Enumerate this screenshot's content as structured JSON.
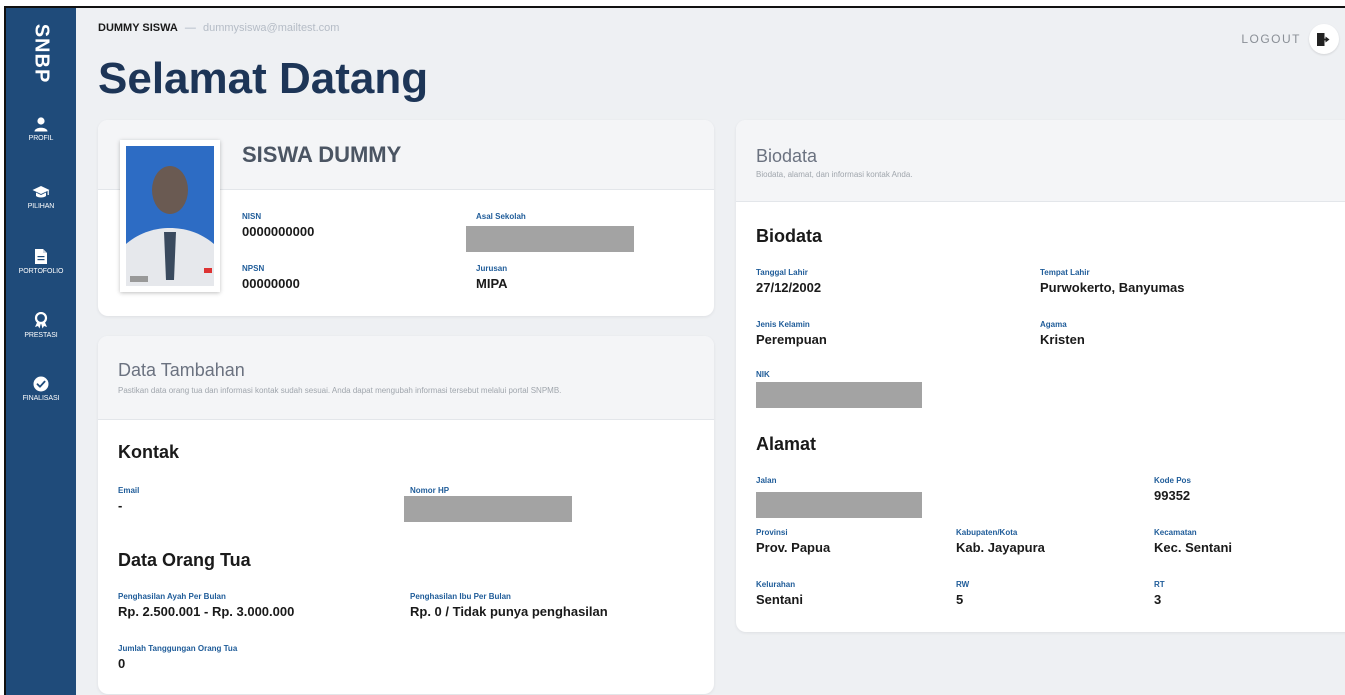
{
  "sidebar": {
    "brand": "SNBP",
    "items": [
      {
        "label": "PROFIL",
        "icon": "user-icon"
      },
      {
        "label": "PILIHAN",
        "icon": "graduation-cap-icon"
      },
      {
        "label": "PORTOFOLIO",
        "icon": "document-icon"
      },
      {
        "label": "PRESTASI",
        "icon": "award-icon"
      },
      {
        "label": "FINALISASI",
        "icon": "check-circle-icon"
      }
    ]
  },
  "header": {
    "user_name": "DUMMY SISWA",
    "separator": "—",
    "user_email": "dummysiswa@mailtest.com",
    "logout_label": "LOGOUT",
    "logout_icon": "logout-icon",
    "page_title": "Selamat Datang"
  },
  "profile": {
    "name": "SISWA DUMMY",
    "nisn_label": "NISN",
    "nisn": "0000000000",
    "npsn_label": "NPSN",
    "npsn": "00000000",
    "school_label": "Asal Sekolah",
    "major_label": "Jurusan",
    "major": "MIPA"
  },
  "tambahan": {
    "title": "Data Tambahan",
    "subtitle": "Pastikan data orang tua dan informasi kontak sudah sesuai. Anda dapat mengubah informasi tersebut melalui portal SNPMB.",
    "kontak_title": "Kontak",
    "email_label": "Email",
    "email": "-",
    "phone_label": "Nomor HP",
    "ortu_title": "Data Orang Tua",
    "father_income_label": "Penghasilan Ayah Per Bulan",
    "father_income": "Rp. 2.500.001 - Rp. 3.000.000",
    "mother_income_label": "Penghasilan Ibu Per Bulan",
    "mother_income": "Rp. 0 / Tidak punya penghasilan",
    "dependents_label": "Jumlah Tanggungan Orang Tua",
    "dependents": "0"
  },
  "biodata": {
    "card_title": "Biodata",
    "card_subtitle": "Biodata, alamat, dan informasi kontak Anda.",
    "section_title": "Biodata",
    "dob_label": "Tanggal Lahir",
    "dob": "27/12/2002",
    "pob_label": "Tempat Lahir",
    "pob": "Purwokerto, Banyumas",
    "gender_label": "Jenis Kelamin",
    "gender": "Perempuan",
    "religion_label": "Agama",
    "religion": "Kristen",
    "nik_label": "NIK",
    "address_title": "Alamat",
    "street_label": "Jalan",
    "postal_label": "Kode Pos",
    "postal": "99352",
    "province_label": "Provinsi",
    "province": "Prov. Papua",
    "regency_label": "Kabupaten/Kota",
    "regency": "Kab. Jayapura",
    "district_label": "Kecamatan",
    "district": "Kec. Sentani",
    "village_label": "Kelurahan",
    "village": "Sentani",
    "rw_label": "RW",
    "rw": "5",
    "rt_label": "RT",
    "rt": "3"
  }
}
